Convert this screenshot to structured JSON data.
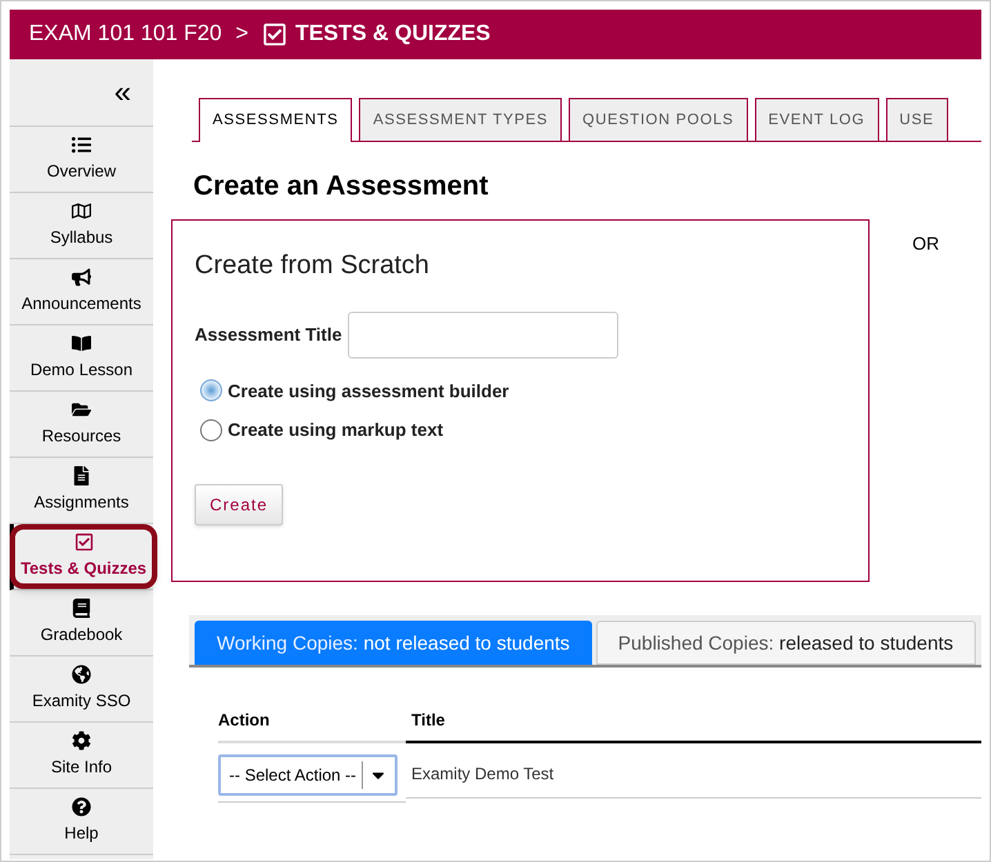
{
  "header": {
    "site": "EXAM 101 101 F20",
    "separator": ">",
    "tool": "TESTS & QUIZZES"
  },
  "sidebar": {
    "collapse": "«",
    "items": [
      {
        "label": "Overview",
        "selected": false
      },
      {
        "label": "Syllabus",
        "selected": false
      },
      {
        "label": "Announcements",
        "selected": false
      },
      {
        "label": "Demo Lesson",
        "selected": false
      },
      {
        "label": "Resources",
        "selected": false
      },
      {
        "label": "Assignments",
        "selected": false
      },
      {
        "label": "Tests & Quizzes",
        "selected": true
      },
      {
        "label": "Gradebook",
        "selected": false
      },
      {
        "label": "Examity SSO",
        "selected": false
      },
      {
        "label": "Site Info",
        "selected": false
      },
      {
        "label": "Help",
        "selected": false
      }
    ]
  },
  "tabs": [
    {
      "label": "ASSESSMENTS",
      "selected": true
    },
    {
      "label": "ASSESSMENT TYPES",
      "selected": false
    },
    {
      "label": "QUESTION POOLS",
      "selected": false
    },
    {
      "label": "EVENT LOG",
      "selected": false
    },
    {
      "label": "USE",
      "selected": false
    }
  ],
  "heading": "Create an Assessment",
  "scratch": {
    "title": "Create from Scratch",
    "field_label": "Assessment Title",
    "options": [
      {
        "label": "Create using assessment builder",
        "selected": true
      },
      {
        "label": "Create using markup text",
        "selected": false
      }
    ],
    "button": "Create"
  },
  "or": "OR",
  "copies_tabs": [
    {
      "label": "Working Copies:",
      "note": "not released to students",
      "selected": true
    },
    {
      "label": "Published Copies:",
      "note": "released to students",
      "selected": false
    }
  ],
  "table": {
    "columns": [
      "Action",
      "Title"
    ],
    "rows": [
      {
        "action": "-- Select Action --",
        "title": "Examity Demo Test"
      }
    ]
  }
}
